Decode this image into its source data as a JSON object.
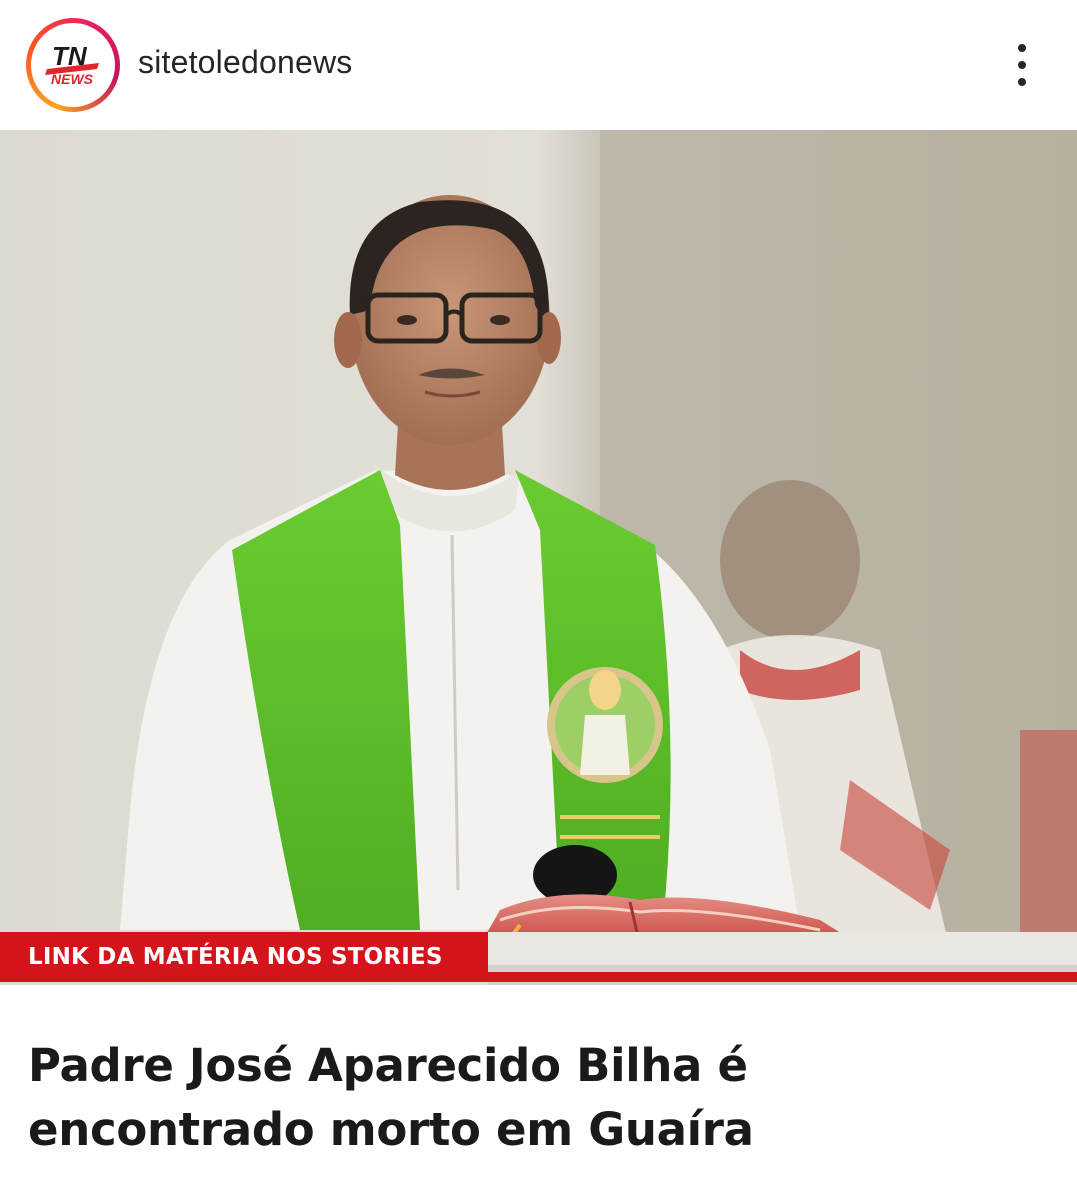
{
  "post": {
    "username": "sitetoledonews",
    "avatar_logo_text_top": "TN",
    "avatar_logo_text_bottom": "NEWS"
  },
  "image": {
    "banner_text": "LINK DA MATÉRIA NOS STORIES",
    "headline": "Padre José Aparecido Bilha é encontrado morto em Guaíra"
  },
  "icons": {
    "more": "more-options-icon"
  },
  "colors": {
    "banner_red": "#d3151b",
    "stole_green": "#5cbf2a",
    "avatar_ring": [
      "#f9a825",
      "#ff5722",
      "#e91e63"
    ]
  }
}
